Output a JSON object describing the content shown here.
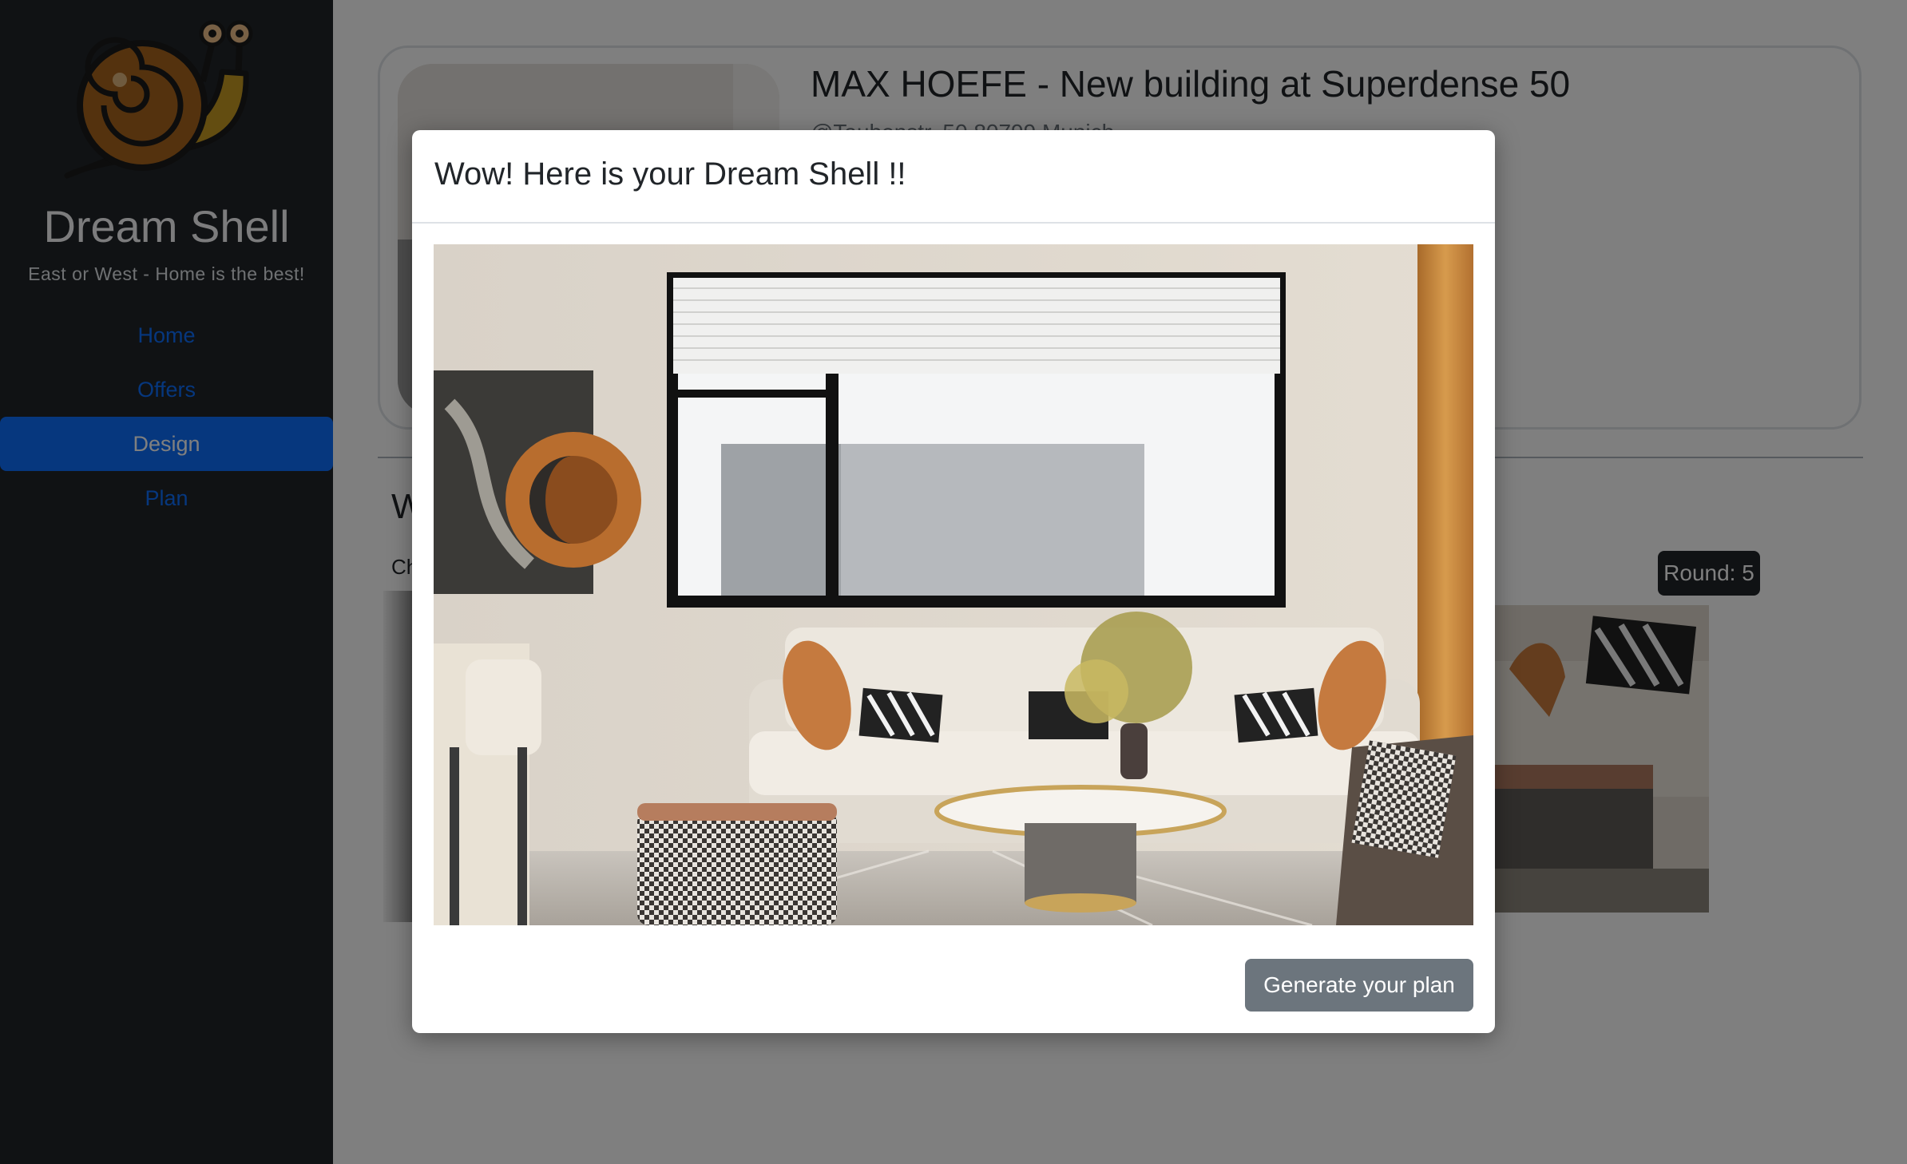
{
  "sidebar": {
    "brand": "Dream Shell",
    "tagline": "East or West - Home is the best!",
    "nav": [
      {
        "label": "Home",
        "active": false
      },
      {
        "label": "Offers",
        "active": false
      },
      {
        "label": "Design",
        "active": true
      },
      {
        "label": "Plan",
        "active": false
      }
    ],
    "logo_icon": "snail-logo"
  },
  "main": {
    "listing": {
      "title": "MAX HOEFE - New building at Superdense 50",
      "address": "@Taubenstr. 50 80799 Munich"
    },
    "section": {
      "heading": "W",
      "sub": "Ch"
    },
    "round_badge": "Round: 5"
  },
  "modal": {
    "title": "Wow! Here is your Dream Shell !!",
    "image_alt": "living room design",
    "generate_button": "Generate your plan"
  },
  "colors": {
    "sidebar_bg": "#212529",
    "accent": "#0d6efd",
    "button_secondary": "#6c757d",
    "overlay": "rgba(0,0,0,0.5)"
  }
}
